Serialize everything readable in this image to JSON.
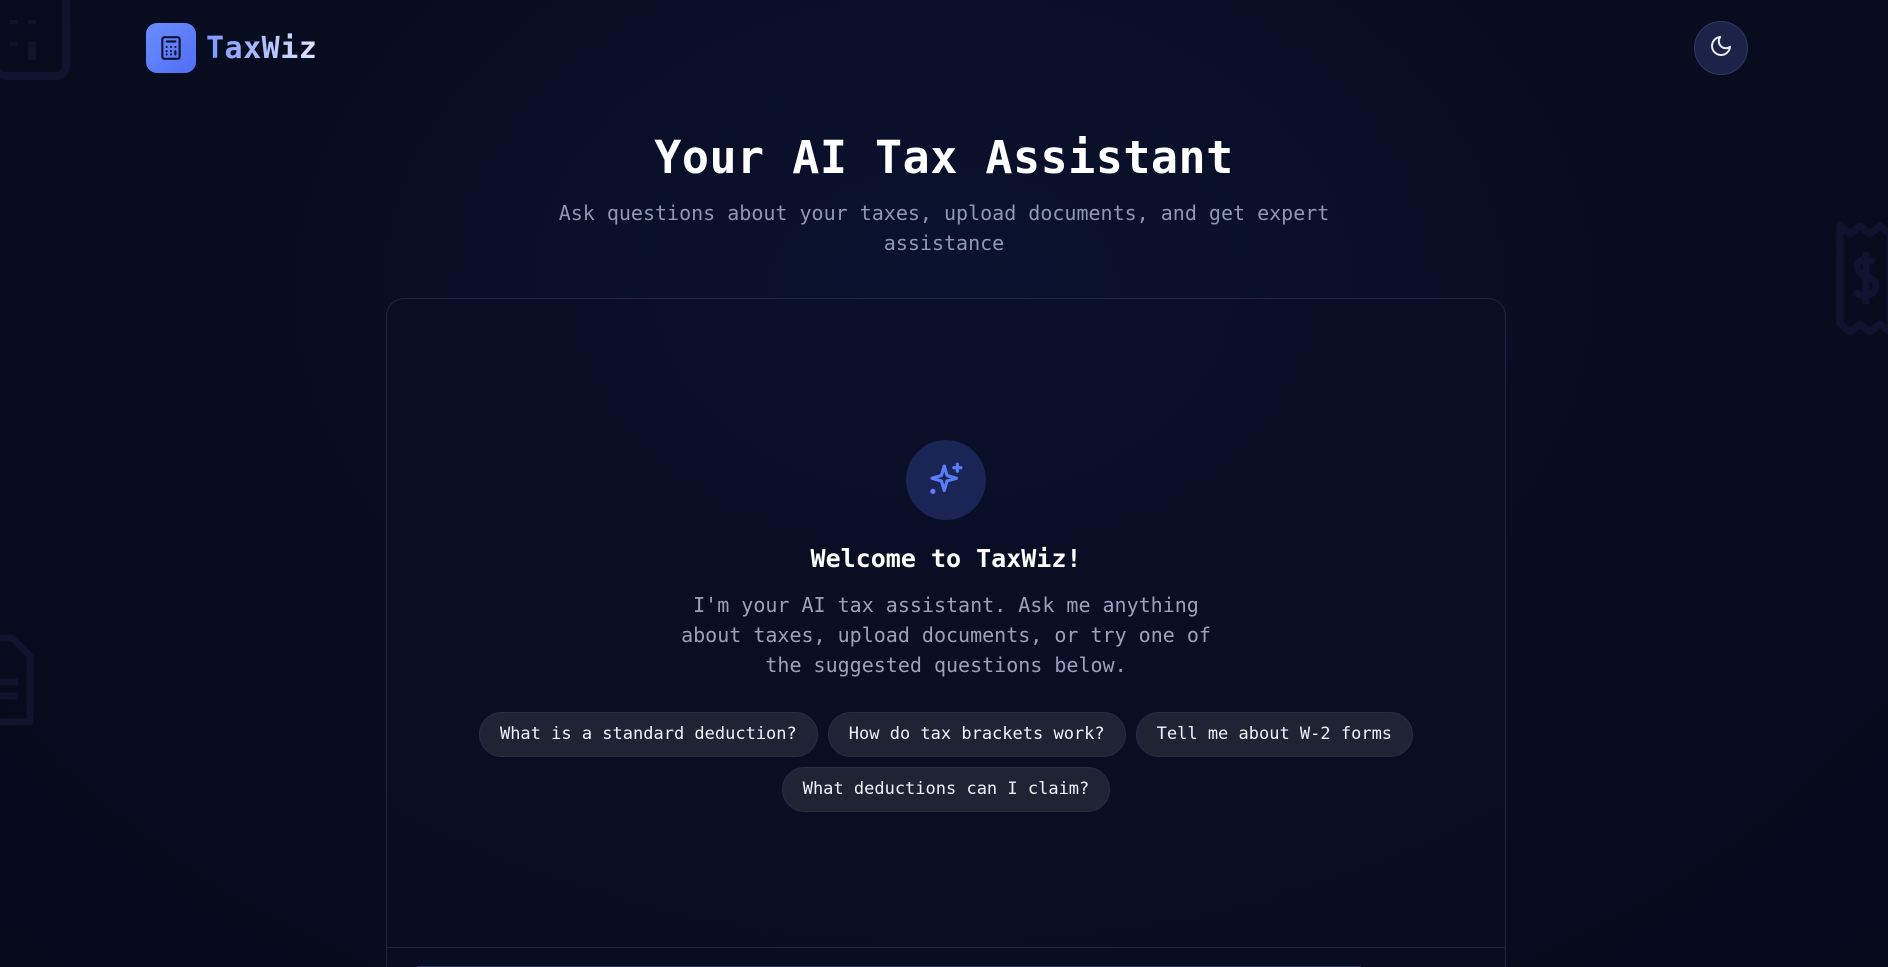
{
  "brand": {
    "name": "TaxWiz",
    "logo_icon": "calculator-icon"
  },
  "header": {
    "theme_toggle_icon": "moon-icon"
  },
  "hero": {
    "title": "Your AI Tax Assistant",
    "subtitle": "Ask questions about your taxes, upload documents, and get expert assistance"
  },
  "chat": {
    "welcome_icon": "sparkles-icon",
    "welcome_title": "Welcome to TaxWiz!",
    "welcome_text": "I'm your AI tax assistant. Ask me anything about taxes, upload documents, or try one of the suggested questions below.",
    "suggestions": [
      {
        "label": "What is a standard deduction?"
      },
      {
        "label": "How do tax brackets work?"
      },
      {
        "label": "Tell me about W-2 forms"
      },
      {
        "label": "What deductions can I claim?"
      }
    ]
  },
  "colors": {
    "background": "#070c1f",
    "accent": "#5b7cfa",
    "panel_border": "#1e2542",
    "chip_bg": "#1e2434",
    "muted_text": "#8f97b3"
  }
}
